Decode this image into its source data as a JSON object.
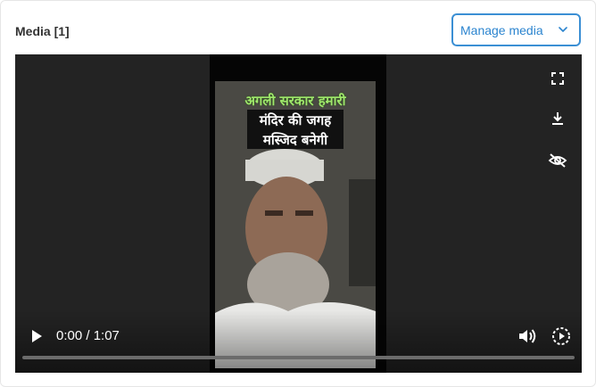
{
  "header": {
    "title": "Media [1]",
    "manage_label": "Manage media"
  },
  "video": {
    "caption_lines": [
      "अगली सरकार हमारी",
      "मंदिर की जगह",
      "मस्जिद बनेगी"
    ],
    "time_display": "0:00 / 1:07",
    "progress": 0,
    "icons": {
      "fullscreen": "fullscreen-icon",
      "download": "download-icon",
      "hide": "eye-off-icon",
      "play": "play-icon",
      "volume": "volume-icon",
      "speed": "playback-speed-icon"
    }
  },
  "colors": {
    "accent": "#3b8fd4",
    "caption_highlight": "#9ee76b"
  }
}
